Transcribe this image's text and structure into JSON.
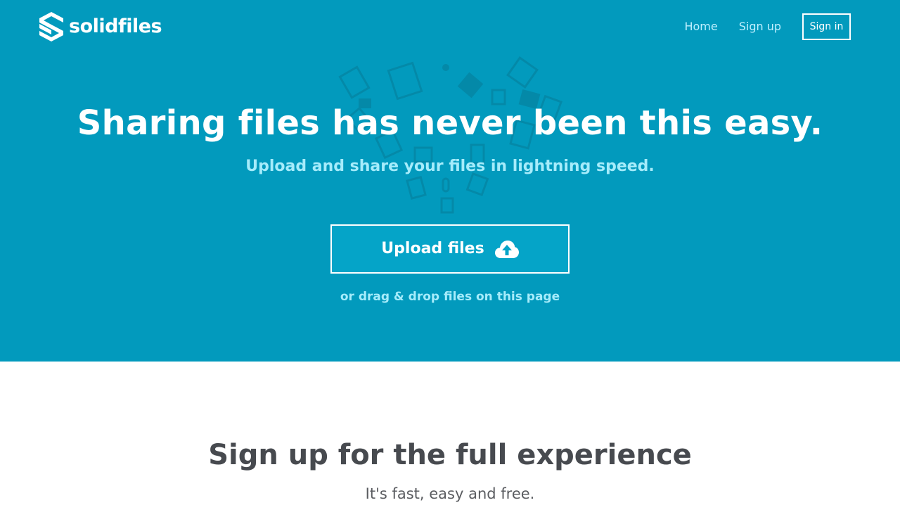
{
  "header": {
    "brand": "solidfiles",
    "nav": {
      "home": "Home",
      "signup": "Sign up",
      "signin": "Sign in"
    }
  },
  "hero": {
    "headline": "Sharing files has never been this easy.",
    "subline": "Upload and share your files in lightning speed.",
    "upload_button": "Upload files",
    "drag_hint": "or drag & drop files on this page"
  },
  "signup": {
    "title": "Sign up for the full experience",
    "subtitle": "It's fast, easy and free."
  },
  "icons": {
    "logo": "solidfiles-logo-mark",
    "upload": "cloud-upload-icon",
    "background": "file-icons-burst"
  },
  "colors": {
    "hero_background": "#029abd",
    "accent_text": "#a6ecfb",
    "nav_text": "#bff0ff",
    "heading_dark": "#474a4f"
  }
}
